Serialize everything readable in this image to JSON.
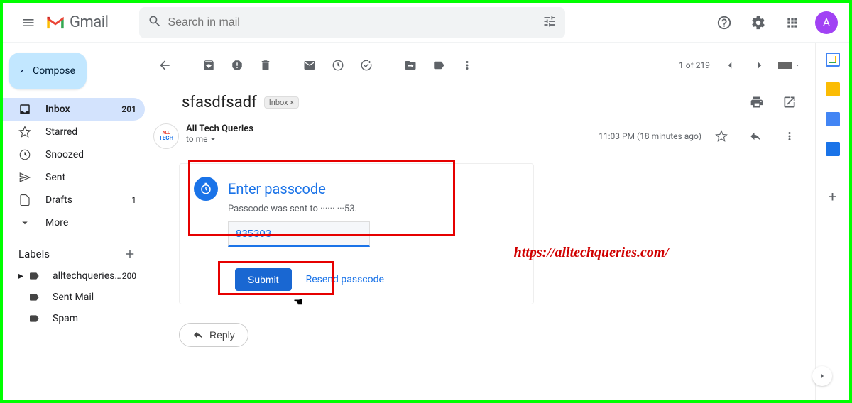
{
  "header": {
    "app_name": "Gmail",
    "search_placeholder": "Search in mail",
    "avatar_letter": "A"
  },
  "compose_label": "Compose",
  "nav": [
    {
      "label": "Inbox",
      "count": "201",
      "active": true
    },
    {
      "label": "Starred"
    },
    {
      "label": "Snoozed"
    },
    {
      "label": "Sent"
    },
    {
      "label": "Drafts",
      "count": "1"
    },
    {
      "label": "More"
    }
  ],
  "labels": {
    "heading": "Labels",
    "items": [
      {
        "label": "alltechqueries@...",
        "count": "200"
      },
      {
        "label": "Sent Mail"
      },
      {
        "label": "Spam"
      }
    ]
  },
  "toolbar": {
    "page_indicator": "1 of 219"
  },
  "message": {
    "subject": "sfasdfsadf",
    "chip": "Inbox ×",
    "sender_name": "All Tech Queries",
    "to_line": "to me",
    "timestamp": "11:03 PM (18 minutes ago)"
  },
  "passcode": {
    "title": "Enter passcode",
    "description": "Passcode was sent to ······ ···53.",
    "input_value": "835303",
    "submit_label": "Submit",
    "resend_label": "Resend passcode"
  },
  "reply_label": "Reply",
  "watermark": "https://alltechqueries.com/"
}
